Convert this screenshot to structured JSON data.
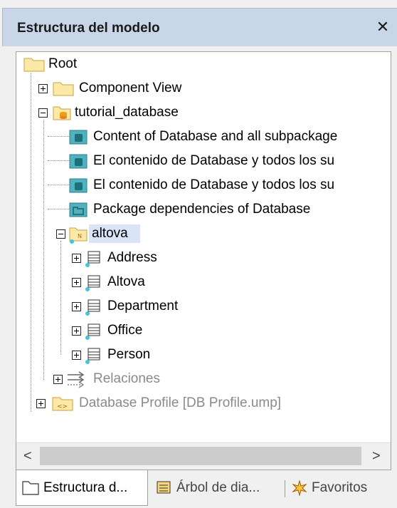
{
  "window": {
    "title": "Estructura del modelo",
    "close_glyph": "✕"
  },
  "tree": {
    "root": "Root",
    "component_view": "Component View",
    "tutorial_database": "tutorial_database",
    "diagrams": [
      "Content of Database and all subpackage",
      "El contenido de Database y todos los su",
      "El contenido de Database y todos los su",
      "Package dependencies of Database"
    ],
    "altova": "altova",
    "classes": [
      "Address",
      "Altova",
      "Department",
      "Office",
      "Person"
    ],
    "relaciones": "Relaciones",
    "database_profile": "Database Profile [DB Profile.ump]"
  },
  "scrollbar": {
    "left_arrow": "<",
    "right_arrow": ">"
  },
  "tabs": [
    {
      "label": "Estructura d...",
      "icon": "folder-icon"
    },
    {
      "label": "Árbol de dia...",
      "icon": "diagram-tree-icon"
    },
    {
      "label": "Favoritos",
      "icon": "favorites-icon"
    }
  ],
  "colors": {
    "folder": "#f7d57a",
    "diagram_icon": "#3aa0a8",
    "selection": "#d9e4f6",
    "titlebar": "#c8d6e8",
    "grey_text": "#8a8a8a"
  }
}
